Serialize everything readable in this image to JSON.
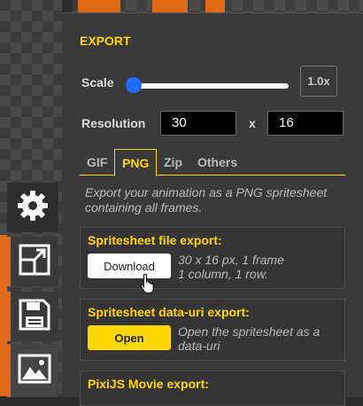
{
  "panel": {
    "title": "EXPORT",
    "scale": {
      "label": "Scale",
      "value_label": "1.0x",
      "level": 0.0
    },
    "resolution": {
      "label": "Resolution",
      "width": "30",
      "separator": "x",
      "height": "16"
    },
    "tabs": [
      {
        "label": "GIF",
        "active": false
      },
      {
        "label": "PNG",
        "active": true
      },
      {
        "label": "Zip",
        "active": false
      },
      {
        "label": "Others",
        "active": false
      }
    ],
    "description": "Export your animation as a PNG spritesheet containing all frames.",
    "sections": {
      "file_export": {
        "title": "Spritesheet file export:",
        "button": "Download",
        "info_line1": "30 x 16 px, 1 frame",
        "info_line2": "1 column, 1 row."
      },
      "data_uri": {
        "title": "Spritesheet data-uri export:",
        "button": "Open",
        "info": "Open the spritesheet as a data-uri"
      },
      "pixijs": {
        "title": "PixiJS Movie export:"
      }
    }
  },
  "tools": [
    {
      "icon": "gear-icon",
      "active": false
    },
    {
      "icon": "resize-icon",
      "active": false
    },
    {
      "icon": "floppy-disk-icon",
      "active": false
    },
    {
      "icon": "image-export-icon",
      "active": true
    }
  ],
  "colors": {
    "accent": "#ffd700",
    "tool_accent": "#e06a15",
    "panel_bg": "#3a3a3a",
    "slider_knob": "#1e6bff"
  }
}
